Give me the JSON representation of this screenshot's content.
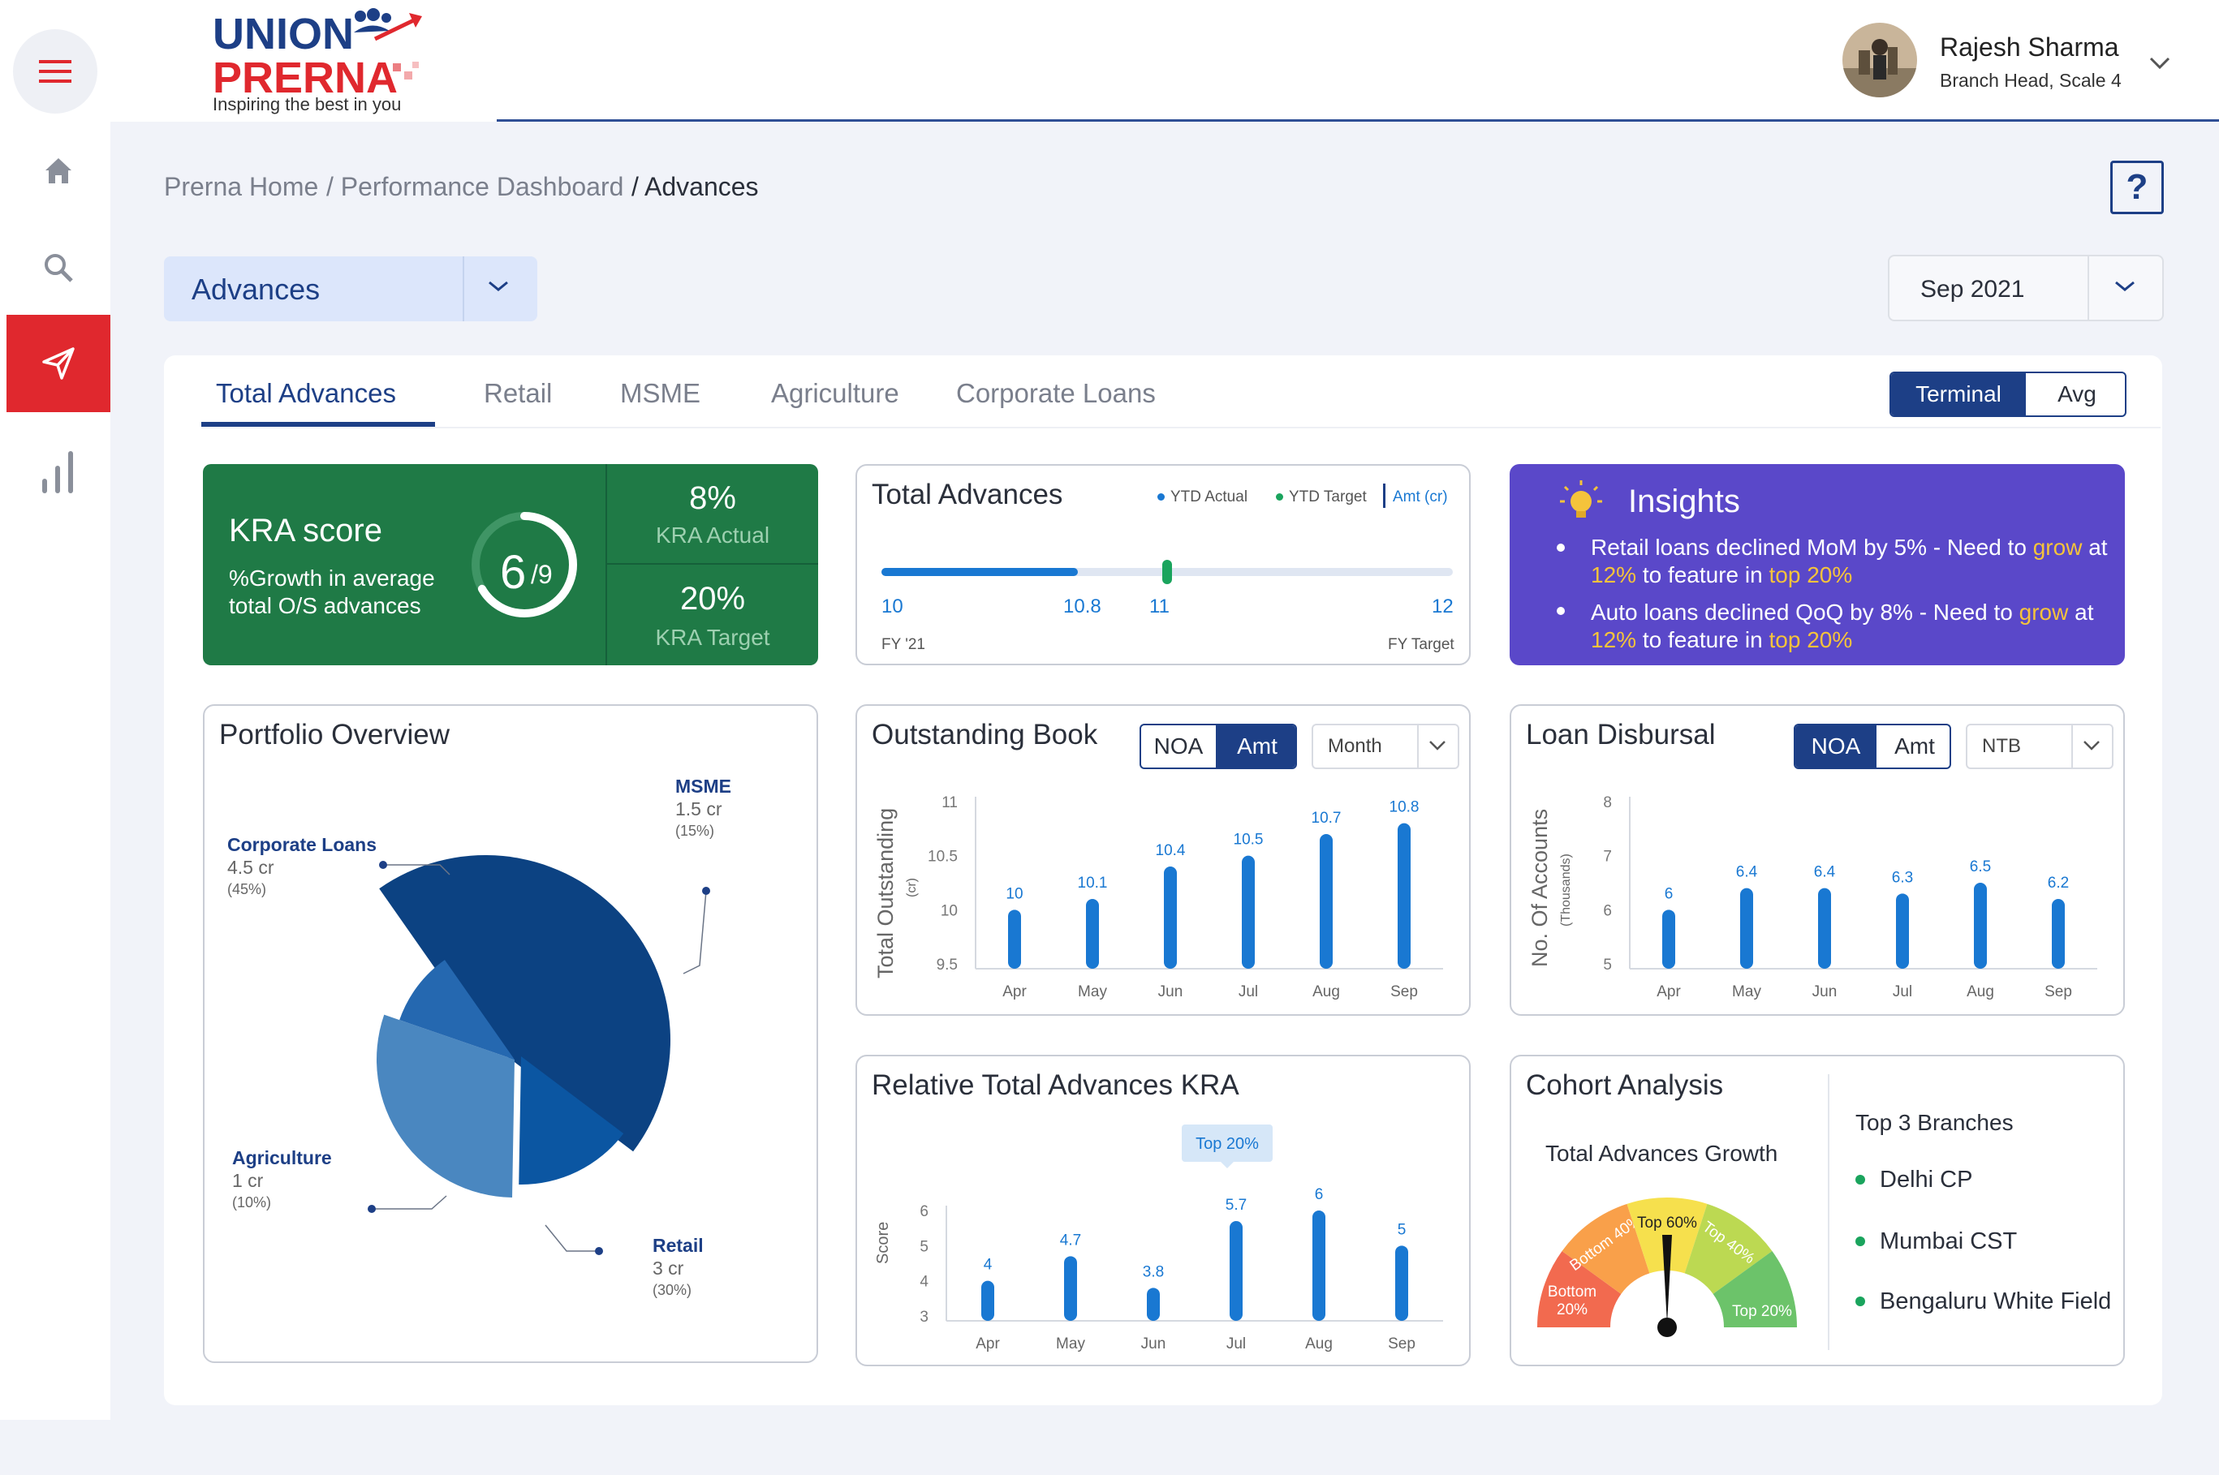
{
  "header": {
    "logo": {
      "brand_top": "UNION",
      "brand_bottom": "PRERNA",
      "tagline": "Inspiring the best in you"
    },
    "user": {
      "name": "Rajesh Sharma",
      "role": "Branch Head, Scale 4"
    }
  },
  "sidebar": {
    "items": [
      {
        "icon": "home-icon",
        "active": false
      },
      {
        "icon": "search-icon",
        "active": false
      },
      {
        "icon": "send-icon",
        "active": true
      },
      {
        "icon": "bar-chart-icon",
        "active": false
      }
    ]
  },
  "breadcrumb": {
    "items": [
      "Prerna Home",
      "/ Performance Dashboard",
      "/ Advances"
    ],
    "help": "?"
  },
  "section_select": {
    "value": "Advances"
  },
  "month_select": {
    "value": "Sep 2021"
  },
  "tabs": [
    "Total Advances",
    "Retail",
    "MSME",
    "Agriculture",
    "Corporate Loans"
  ],
  "view_toggle": {
    "options": [
      "Terminal",
      "Avg"
    ],
    "selected": "Terminal"
  },
  "kra": {
    "title": "KRA score",
    "description": "%Growth in average total O/S advances",
    "score": "6",
    "score_denominator": "/9",
    "score_fraction": 0.667,
    "actual_value": "8%",
    "actual_label": "KRA Actual",
    "target_value": "20%",
    "target_label": "KRA Target"
  },
  "total_advances": {
    "title": "Total Advances",
    "legend": {
      "actual": "YTD Actual",
      "target": "YTD Target",
      "unit": "Amt (cr)"
    },
    "labels": [
      "10",
      "10.8",
      "11",
      "12"
    ],
    "start": 10,
    "end": 12,
    "ytd_actual": 10.8,
    "ytd_target": 11,
    "footer_left": "FY '21",
    "footer_right": "FY Target",
    "colors": {
      "actual": "#1978d2",
      "target": "#1aa45d"
    }
  },
  "insights": {
    "title": "Insights",
    "items": [
      {
        "pre": "Retail loans declined MoM by 5% - Need to ",
        "grow": "grow",
        "mid1": " at ",
        "pct": "12%",
        "mid2": " to feature in ",
        "top": "top 20%"
      },
      {
        "pre": "Auto loans declined QoQ by 8% - Need to ",
        "grow": "grow",
        "mid1": " at ",
        "pct": "12%",
        "mid2": " to feature in ",
        "top": "top 20%"
      }
    ]
  },
  "portfolio": {
    "title": "Portfolio Overview",
    "segments": [
      {
        "name": "Corporate Loans",
        "value": "4.5 cr",
        "pct": "(45%)",
        "share": 45,
        "color": "#0c4282"
      },
      {
        "name": "MSME",
        "value": "1.5 cr",
        "pct": "(15%)",
        "share": 15,
        "color": "#0b56a2"
      },
      {
        "name": "Retail",
        "value": "3 cr",
        "pct": "(30%)",
        "share": 30,
        "color": "#4a87c0"
      },
      {
        "name": "Agriculture",
        "value": "1 cr",
        "pct": "(10%)",
        "share": 10,
        "color": "#2568b0"
      }
    ]
  },
  "outstanding": {
    "title": "Outstanding Book",
    "toggle": [
      "NOA",
      "Amt"
    ],
    "selected": "Amt",
    "dropdown": "Month",
    "ylabel": "Total Outstanding",
    "ylabel_unit": "(cr)"
  },
  "disbursal": {
    "title": "Loan Disbursal",
    "toggle": [
      "NOA",
      "Amt"
    ],
    "selected": "NOA",
    "dropdown": "NTB",
    "ylabel": "No. Of Accounts",
    "ylabel_unit": "(Thousands)"
  },
  "relative": {
    "title": "Relative Total Advances KRA",
    "ylabel": "Score",
    "tooltip": "Top 20%"
  },
  "cohort": {
    "title": "Cohort Analysis",
    "subtitle": "Total Advances Growth",
    "gauge_labels": [
      "Bottom 20%",
      "Bottom 40%",
      "Top 60%",
      "Top 40%",
      "Top 20%"
    ],
    "gauge_colors": [
      "#f26a4f",
      "#f9a04a",
      "#f6e04d",
      "#bcd952",
      "#6cc36a"
    ],
    "needle_segment": "Top 60%",
    "top3_title": "Top 3 Branches",
    "branches": [
      "Delhi CP",
      "Mumbai CST",
      "Bengaluru White Field"
    ]
  },
  "chart_data": [
    {
      "type": "bar",
      "title": "Outstanding Book",
      "ylabel": "Total Outstanding (cr)",
      "categories": [
        "Apr",
        "May",
        "Jun",
        "Jul",
        "Aug",
        "Sep"
      ],
      "values": [
        10,
        10.1,
        10.4,
        10.5,
        10.7,
        10.8
      ],
      "ylim": [
        9.5,
        11
      ],
      "yticks": [
        9.5,
        10,
        10.5,
        11
      ],
      "color": "#1978d2"
    },
    {
      "type": "bar",
      "title": "Loan Disbursal",
      "ylabel": "No. Of Accounts (Thousands)",
      "categories": [
        "Apr",
        "May",
        "Jun",
        "Jul",
        "Aug",
        "Sep"
      ],
      "values": [
        6,
        6.4,
        6.4,
        6.3,
        6.5,
        6.2
      ],
      "ylim": [
        5,
        8
      ],
      "yticks": [
        5,
        6,
        7,
        8
      ],
      "color": "#1978d2"
    },
    {
      "type": "bar",
      "title": "Relative Total Advances KRA",
      "ylabel": "Score",
      "categories": [
        "Apr",
        "May",
        "Jun",
        "Jul",
        "Aug",
        "Sep"
      ],
      "values": [
        4,
        4.7,
        3.8,
        5.7,
        6,
        5
      ],
      "ylim": [
        3,
        6
      ],
      "yticks": [
        3,
        4,
        5,
        6
      ],
      "color": "#1978d2"
    }
  ]
}
